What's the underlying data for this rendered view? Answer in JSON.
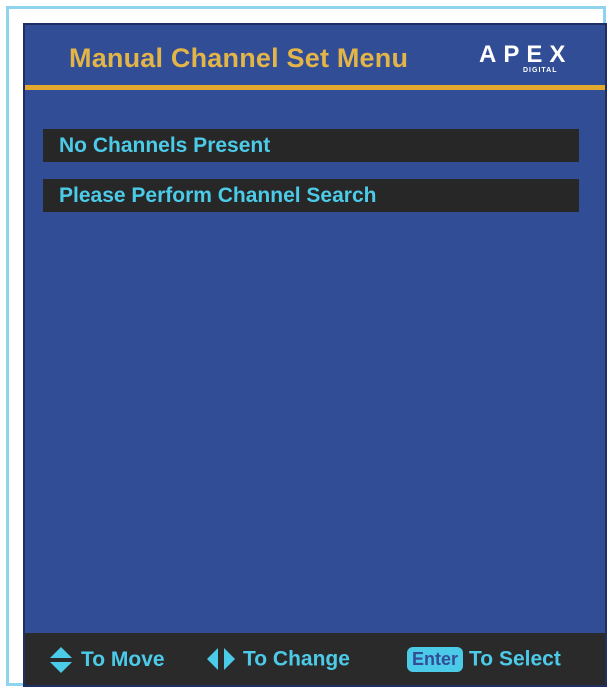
{
  "header": {
    "title": "Manual Channel Set  Menu",
    "brand": "APEX",
    "brand_sub": "DIGITAL"
  },
  "messages": [
    "No Channels Present",
    "Please Perform Channel Search"
  ],
  "footer": {
    "move": {
      "icon": "up-down-arrow-icon",
      "label": "To Move"
    },
    "change": {
      "icon": "left-right-arrow-icon",
      "label": "To Change"
    },
    "select": {
      "key": "Enter",
      "label": "To Select"
    }
  },
  "colors": {
    "background": "#314d96",
    "title": "#e3b548",
    "accent_rule": "#e3a92e",
    "message_bg": "#272727",
    "hint_text": "#4ccbe9"
  }
}
